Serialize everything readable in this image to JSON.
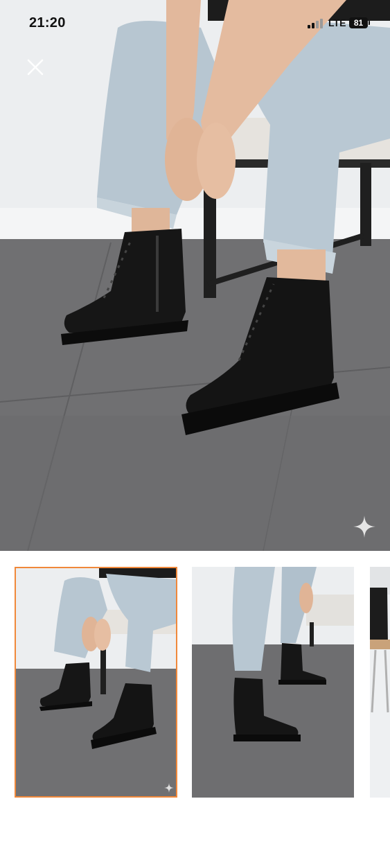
{
  "status_bar": {
    "time": "21:20",
    "network": "LTE",
    "battery": "81"
  },
  "viewer": {
    "close_icon": "close-icon",
    "sparkle_icon": "sparkle-icon",
    "selected_thumbnail": 1
  },
  "thumbnails": [
    {
      "index": 1,
      "selected": true
    },
    {
      "index": 2,
      "selected": false
    },
    {
      "index": 3,
      "selected": false
    }
  ],
  "colors": {
    "selected_border": "#f0883a",
    "background": "#ffffff"
  }
}
